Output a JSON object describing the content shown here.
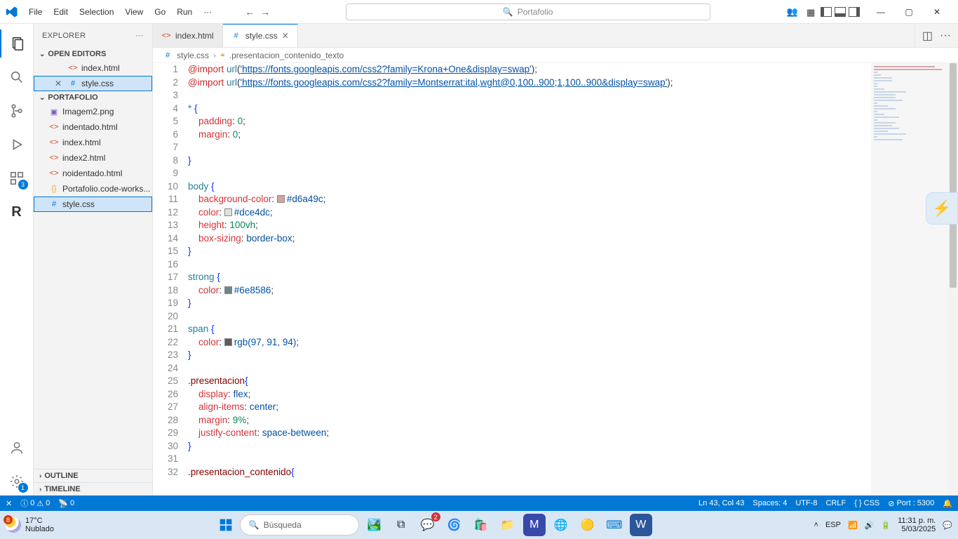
{
  "menu": {
    "file": "File",
    "edit": "Edit",
    "selection": "Selection",
    "view": "View",
    "go": "Go",
    "run": "Run",
    "more": "···"
  },
  "search_center": "Portafolio",
  "window": {
    "min": "—",
    "max": "▢",
    "close": "✕"
  },
  "activity": {
    "badge_ext": "3",
    "badge_settings": "1"
  },
  "explorer": {
    "title": "EXPLORER",
    "more": "···",
    "open_editors": "OPEN EDITORS",
    "folder": "PORTAFOLIO",
    "outline": "OUTLINE",
    "timeline": "TIMELINE",
    "editors": [
      {
        "icon": "html",
        "name": "index.html",
        "close": false
      },
      {
        "icon": "css",
        "name": "style.css",
        "close": true,
        "active": true
      }
    ],
    "files": [
      {
        "icon": "img",
        "name": "Imagem2.png"
      },
      {
        "icon": "html",
        "name": "indentado.html"
      },
      {
        "icon": "html",
        "name": "index.html"
      },
      {
        "icon": "html",
        "name": "index2.html"
      },
      {
        "icon": "html",
        "name": "noidentado.html"
      },
      {
        "icon": "json",
        "name": "Portafolio.code-works..."
      },
      {
        "icon": "css",
        "name": "style.css",
        "active": true
      }
    ]
  },
  "tabs": [
    {
      "icon": "html",
      "name": "index.html"
    },
    {
      "icon": "css",
      "name": "style.css",
      "active": true,
      "close": true
    }
  ],
  "breadcrumb": {
    "file": "style.css",
    "symbol": ".presentacion_contenido_texto"
  },
  "code": {
    "url1": "'https://fonts.googleapis.com/css2?family=Krona+One&display=swap'",
    "url2": "'https://fonts.googleapis.com/css2?family=Montserrat:ital,wght@0,100..900;1,100..900&display=swap'",
    "c_body_bg": "#d6a49c",
    "c_body_fg": "#dce4dc",
    "c_strong": "#6e8586",
    "c_span": "rgb(97, 91, 94)"
  },
  "status": {
    "errors": "0",
    "warnings": "0",
    "ports": "0",
    "pos": "Ln 43, Col 43",
    "spaces": "Spaces: 4",
    "enc": "UTF-8",
    "eol": "CRLF",
    "lang": "CSS",
    "port": "Port : 5300",
    "bell": "🔔",
    "no_entry": "⊘"
  },
  "taskbar": {
    "temp": "17°C",
    "cond": "Nublado",
    "wbadge": "8",
    "search": "Búsqueda",
    "tray_lang": "ESP",
    "time": "11:31 p. m.",
    "date": "5/03/2025"
  }
}
